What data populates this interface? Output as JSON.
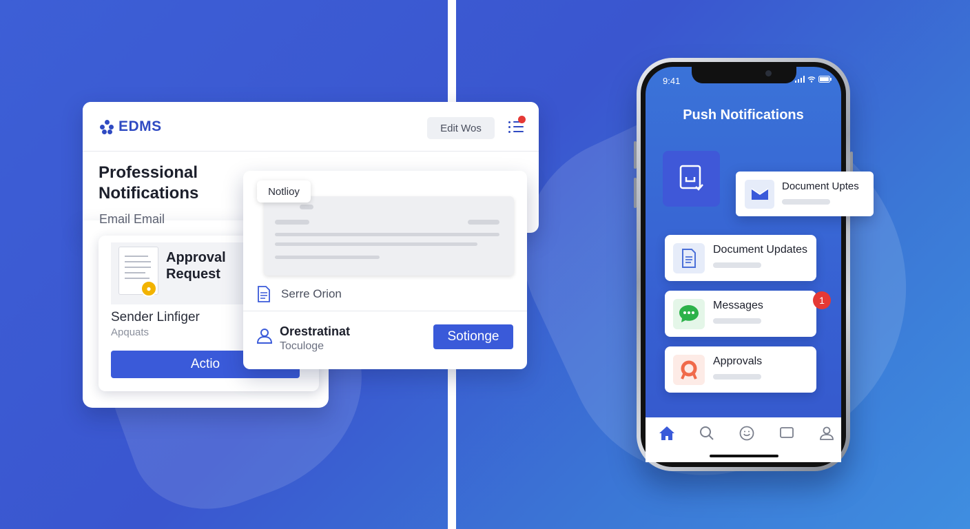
{
  "edms": {
    "logo_text": "EDMS",
    "edit_label": "Edit Wos",
    "title": "Professional Notifications",
    "subtitle": "Email Email",
    "approval": {
      "title": "Approval Request",
      "sender": "Sender Linfiger",
      "apps": "Apquats",
      "action_label": "Actio"
    }
  },
  "notify": {
    "chip": "Notlioy",
    "serve_text": "Serre Orion",
    "contact_name": "Orestratinat",
    "contact_sub": "Toculoge",
    "action_label": "Sotionge"
  },
  "phone": {
    "time": "9:41",
    "screen_title": "Push Notifications",
    "float_card_title": "Document Uptes",
    "notifications": [
      {
        "title": "Document Updates",
        "icon": "document-icon",
        "color": "#4a6fd8"
      },
      {
        "title": "Messages",
        "icon": "chat-icon",
        "color": "#2cb24a",
        "badge": "1"
      },
      {
        "title": "Approvals",
        "icon": "approval-icon",
        "color": "#f06a4a"
      }
    ],
    "tabs": [
      "home-icon",
      "search-icon",
      "smile-icon",
      "message-icon",
      "profile-icon"
    ]
  },
  "colors": {
    "brand": "#2f4ac2",
    "primary_button": "#3a5ad9",
    "badge": "#e53935",
    "background": "#3d5fd6"
  }
}
